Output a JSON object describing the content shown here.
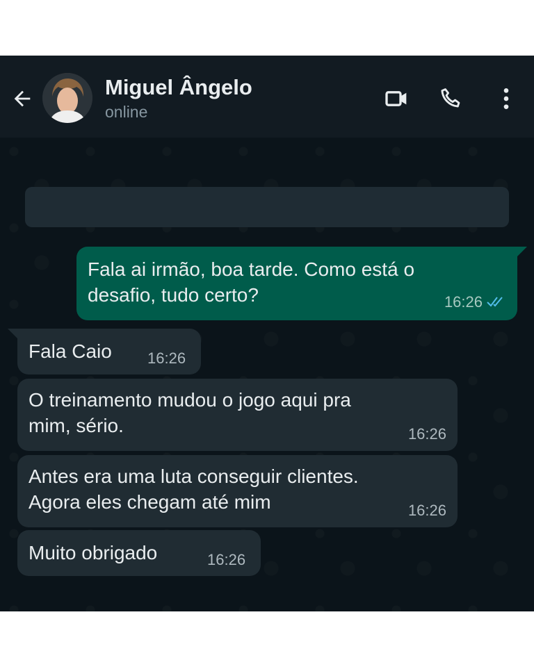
{
  "header": {
    "contact_name": "Miguel Ângelo",
    "status": "online",
    "icons": [
      "back-arrow-icon",
      "video-call-icon",
      "phone-icon",
      "more-vertical-icon"
    ]
  },
  "colors": {
    "header_bg": "#121b22",
    "chat_bg": "#0b141a",
    "outgoing_bubble": "#005c4b",
    "incoming_bubble": "#202c33",
    "read_ticks": "#53bdeb"
  },
  "messages": [
    {
      "direction": "out",
      "lines": [
        "Fala ai irmão, boa tarde. Como está o",
        "desafio, tudo certo?"
      ],
      "time": "16:26",
      "status": "read"
    },
    {
      "direction": "in",
      "lines": [
        "Fala Caio"
      ],
      "time": "16:26"
    },
    {
      "direction": "in",
      "lines": [
        "O treinamento mudou o jogo aqui pra",
        "mim, sério."
      ],
      "time": "16:26"
    },
    {
      "direction": "in",
      "lines": [
        "Antes era uma luta conseguir clientes.",
        "Agora eles chegam até mim"
      ],
      "time": "16:26"
    },
    {
      "direction": "in",
      "lines": [
        "Muito obrigado"
      ],
      "time": "16:26"
    }
  ]
}
